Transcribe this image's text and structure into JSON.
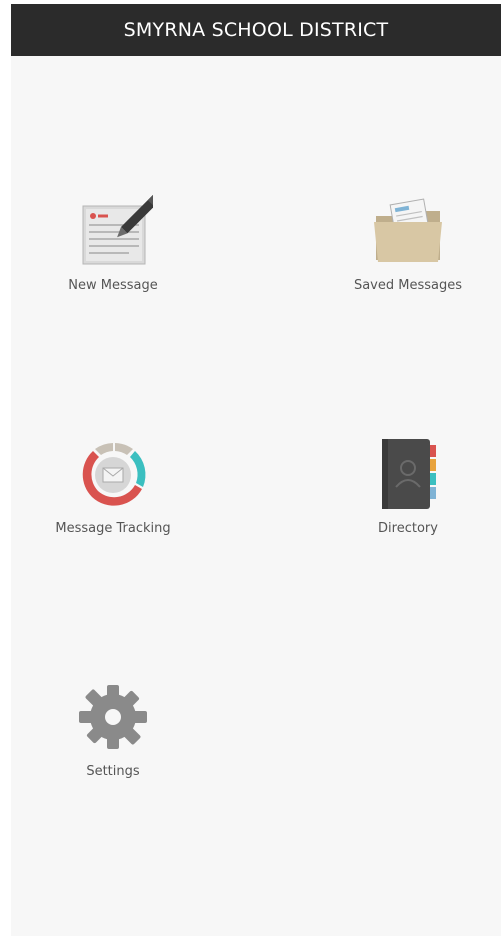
{
  "header": {
    "title": "SMYRNA SCHOOL DISTRICT"
  },
  "tiles": [
    {
      "label": "New Message",
      "icon": "new-message-icon"
    },
    {
      "label": "Saved Messages",
      "icon": "folder-icon"
    },
    {
      "label": "Message Tracking",
      "icon": "message-tracking-icon"
    },
    {
      "label": "Directory",
      "icon": "directory-book-icon"
    },
    {
      "label": "Settings",
      "icon": "gear-icon"
    }
  ],
  "colors": {
    "header_bg": "#2b2b2b",
    "page_bg": "#f7f7f7",
    "tracking_red": "#d9534f",
    "tracking_teal": "#3bbfc0"
  }
}
